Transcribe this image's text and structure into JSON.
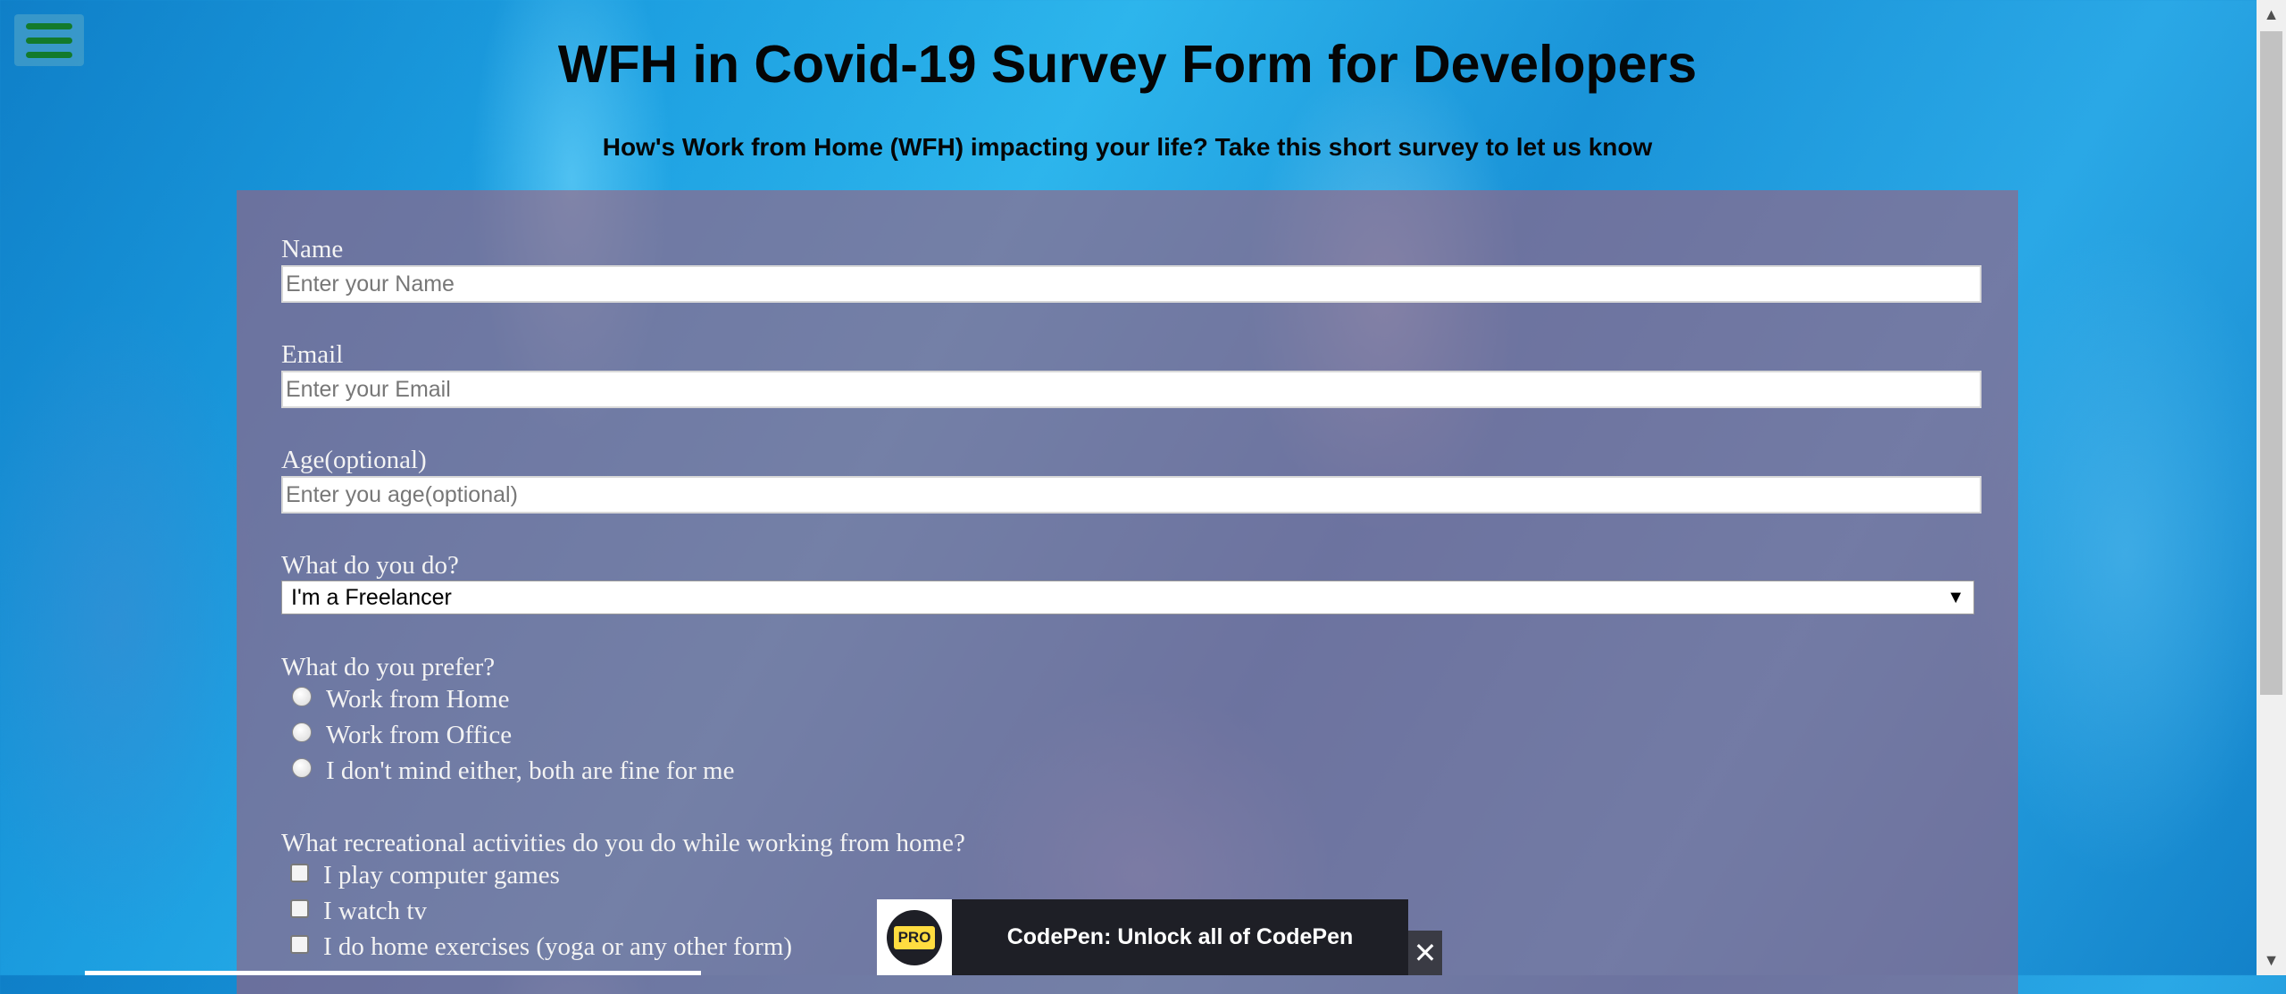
{
  "menu": {
    "icon": "hamburger-menu-icon"
  },
  "header": {
    "title": "WFH in Covid-19 Survey Form for Developers",
    "subtitle": "How's Work from Home (WFH) impacting your life? Take this short survey to let us know"
  },
  "form": {
    "name": {
      "label": "Name",
      "placeholder": "Enter your Name"
    },
    "email": {
      "label": "Email",
      "placeholder": "Enter your Email"
    },
    "age": {
      "label": "Age(optional)",
      "placeholder": "Enter you age(optional)"
    },
    "role": {
      "label": "What do you do?",
      "selected": "I'm a Freelancer",
      "arrow": "▼"
    },
    "preference": {
      "label": "What do you prefer?",
      "options": [
        "Work from Home",
        "Work from Office",
        "I don't mind either, both are fine for me"
      ]
    },
    "activities": {
      "label": "What recreational activities do you do while working from home?",
      "options": [
        "I play computer games",
        "I watch tv",
        "I do home exercises (yoga or any other form)"
      ]
    }
  },
  "promo": {
    "badge": "PRO",
    "text": "CodePen: Unlock all of CodePen",
    "close": "✕"
  },
  "scrollbar": {
    "up": "▲",
    "down": "▼"
  },
  "colors": {
    "title": "#050505",
    "panel": "#a05f7d",
    "promo_bg": "#1e1f26",
    "promo_badge": "#ffdd40",
    "menu_bars": "#137a2c"
  }
}
